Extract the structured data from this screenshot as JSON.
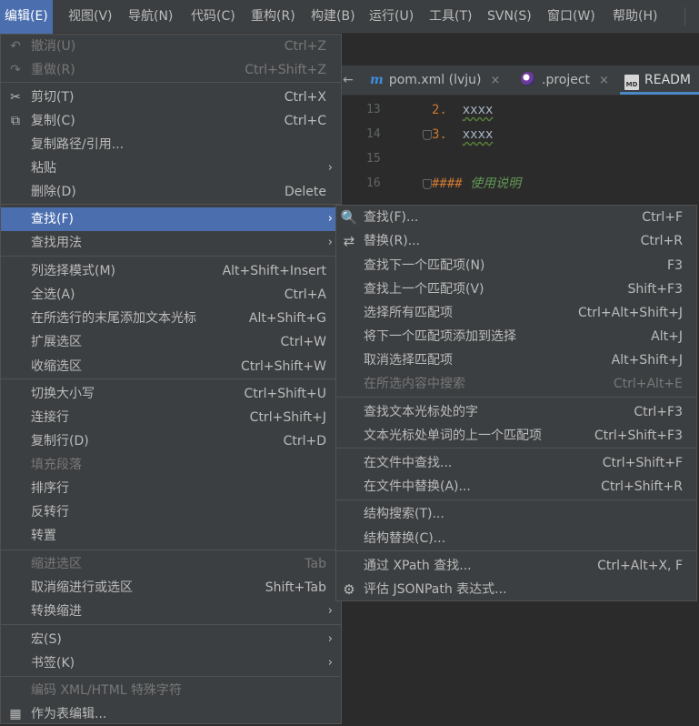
{
  "menubar": [
    {
      "label": "编辑(E)"
    },
    {
      "label": "视图(V)"
    },
    {
      "label": "导航(N)"
    },
    {
      "label": "代码(C)"
    },
    {
      "label": "重构(R)"
    },
    {
      "label": "构建(B)"
    },
    {
      "label": "运行(U)"
    },
    {
      "label": "工具(T)"
    },
    {
      "label": "SVN(S)"
    },
    {
      "label": "窗口(W)"
    },
    {
      "label": "帮助(H)"
    }
  ],
  "tabs": [
    {
      "label": "pom.xml (lvju)",
      "close": "×"
    },
    {
      "label": ".project",
      "close": "×"
    },
    {
      "label": "READM"
    }
  ],
  "tab_icons": {
    "m": "m",
    "md": "MD"
  },
  "editor_lines": [
    {
      "num": "13",
      "prefix": "2.",
      "text": "xxxx"
    },
    {
      "num": "14",
      "prefix": "3.",
      "text": "xxxx"
    },
    {
      "num": "15",
      "prefix": "",
      "text": ""
    },
    {
      "num": "16",
      "prefix": "####",
      "text": "使用说明"
    }
  ],
  "edit_menu": [
    {
      "label": "撤消(U)",
      "shortcut": "Ctrl+Z",
      "disabled": true,
      "icon": "undo-icon"
    },
    {
      "label": "重做(R)",
      "shortcut": "Ctrl+Shift+Z",
      "disabled": true,
      "icon": "redo-icon"
    },
    {
      "label": "剪切(T)",
      "shortcut": "Ctrl+X",
      "icon": "scissors-icon"
    },
    {
      "label": "复制(C)",
      "shortcut": "Ctrl+C",
      "icon": "copy-icon"
    },
    {
      "label": "复制路径/引用...",
      "shortcut": ""
    },
    {
      "label": "粘贴",
      "shortcut": "",
      "submenu": true
    },
    {
      "label": "删除(D)",
      "shortcut": "Delete"
    },
    {
      "label": "查找(F)",
      "shortcut": "",
      "submenu": true,
      "highlighted": true
    },
    {
      "label": "查找用法",
      "shortcut": "",
      "submenu": true
    },
    {
      "label": "列选择模式(M)",
      "shortcut": "Alt+Shift+Insert"
    },
    {
      "label": "全选(A)",
      "shortcut": "Ctrl+A"
    },
    {
      "label": "在所选行的末尾添加文本光标",
      "shortcut": "Alt+Shift+G"
    },
    {
      "label": "扩展选区",
      "shortcut": "Ctrl+W"
    },
    {
      "label": "收缩选区",
      "shortcut": "Ctrl+Shift+W"
    },
    {
      "label": "切换大小写",
      "shortcut": "Ctrl+Shift+U"
    },
    {
      "label": "连接行",
      "shortcut": "Ctrl+Shift+J"
    },
    {
      "label": "复制行(D)",
      "shortcut": "Ctrl+D"
    },
    {
      "label": "填充段落",
      "shortcut": "",
      "disabled": true
    },
    {
      "label": "排序行",
      "shortcut": ""
    },
    {
      "label": "反转行",
      "shortcut": ""
    },
    {
      "label": "转置",
      "shortcut": ""
    },
    {
      "label": "缩进选区",
      "shortcut": "Tab",
      "disabled": true
    },
    {
      "label": "取消缩进行或选区",
      "shortcut": "Shift+Tab"
    },
    {
      "label": "转换缩进",
      "shortcut": "",
      "submenu": true
    },
    {
      "label": "宏(S)",
      "shortcut": "",
      "submenu": true
    },
    {
      "label": "书签(K)",
      "shortcut": "",
      "submenu": true
    },
    {
      "label": "编码 XML/HTML 特殊字符",
      "shortcut": "",
      "disabled": true
    },
    {
      "label": "作为表编辑...",
      "shortcut": "",
      "icon": "table-icon"
    }
  ],
  "find_menu": [
    {
      "label": "查找(F)...",
      "shortcut": "Ctrl+F",
      "icon": "search-icon"
    },
    {
      "label": "替换(R)...",
      "shortcut": "Ctrl+R",
      "icon": "replace-icon"
    },
    {
      "label": "查找下一个匹配项(N)",
      "shortcut": "F3"
    },
    {
      "label": "查找上一个匹配项(V)",
      "shortcut": "Shift+F3"
    },
    {
      "label": "选择所有匹配项",
      "shortcut": "Ctrl+Alt+Shift+J"
    },
    {
      "label": "将下一个匹配项添加到选择",
      "shortcut": "Alt+J"
    },
    {
      "label": "取消选择匹配项",
      "shortcut": "Alt+Shift+J"
    },
    {
      "label": "在所选内容中搜索",
      "shortcut": "Ctrl+Alt+E",
      "disabled": true
    },
    {
      "label": "查找文本光标处的字",
      "shortcut": "Ctrl+F3"
    },
    {
      "label": "文本光标处单词的上一个匹配项",
      "shortcut": "Ctrl+Shift+F3"
    },
    {
      "label": "在文件中查找...",
      "shortcut": "Ctrl+Shift+F"
    },
    {
      "label": "在文件中替换(A)...",
      "shortcut": "Ctrl+Shift+R"
    },
    {
      "label": "结构搜索(T)...",
      "shortcut": ""
    },
    {
      "label": "结构替换(C)...",
      "shortcut": ""
    },
    {
      "label": "通过 XPath 查找...",
      "shortcut": "Ctrl+Alt+X, F"
    },
    {
      "label": "评估 JSONPath 表达式...",
      "shortcut": "",
      "icon": "jsonpath-icon"
    }
  ],
  "glyphs": {
    "submenu_arrow": "›",
    "undo": "↶",
    "redo": "↷",
    "scissors": "✂",
    "copy": "⧉",
    "search": "🔍",
    "replace": "⇄",
    "table": "▦",
    "jsonpath": "⚙",
    "left_arrow": "←"
  }
}
